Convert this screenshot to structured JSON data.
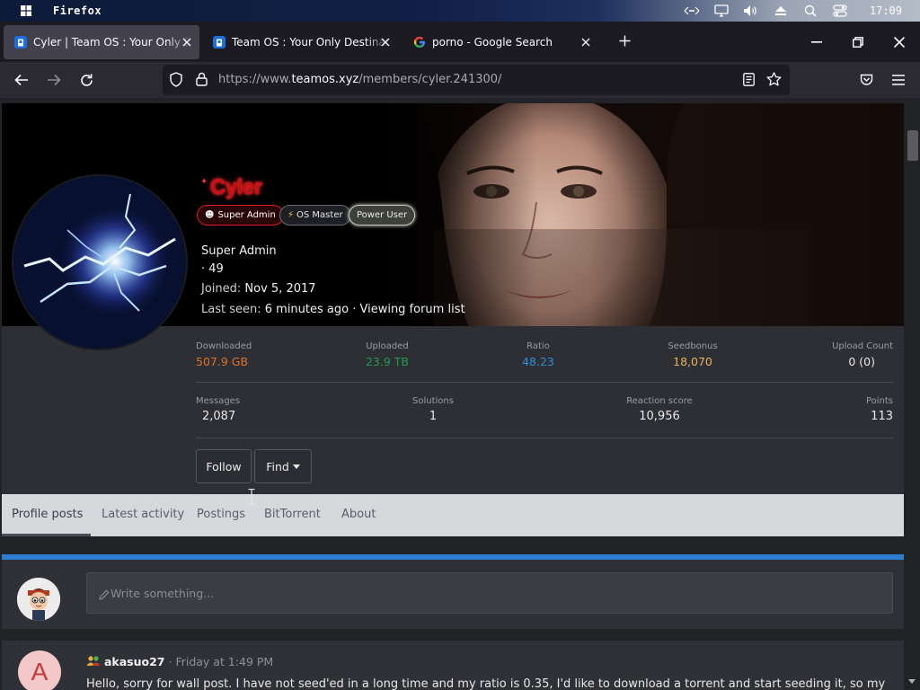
{
  "os": {
    "app_name": "Firefox",
    "clock": "17:09"
  },
  "browser": {
    "tabs": [
      {
        "title": "Cyler | Team OS : Your Only Destination",
        "active": true
      },
      {
        "title": "Team OS : Your Only Destination",
        "active": false
      },
      {
        "title": "porno - Google Search",
        "active": false
      }
    ],
    "url_prefix": "https://www.",
    "url_domain": "teamos.xyz",
    "url_path": "/members/cyler.241300/"
  },
  "profile": {
    "username": "Cyler",
    "badges": {
      "super_admin": "Super Admin",
      "os_master": "OS Master",
      "power_user": "Power User"
    },
    "title": "Super Admin",
    "rank": "· 49",
    "joined_label": "Joined:",
    "joined_value": "Nov 5, 2017",
    "last_seen_label": "Last seen:",
    "last_seen_value": "6 minutes ago · Viewing forum list",
    "stats_top": {
      "downloaded": {
        "label": "Downloaded",
        "value": "507.9 GB"
      },
      "uploaded": {
        "label": "Uploaded",
        "value": "23.9 TB"
      },
      "ratio": {
        "label": "Ratio",
        "value": "48.23"
      },
      "seedbonus": {
        "label": "Seedbonus",
        "value": "18,070"
      },
      "upload_count": {
        "label": "Upload Count",
        "value": "0 (0)"
      }
    },
    "stats_bottom": {
      "messages": {
        "label": "Messages",
        "value": "2,087"
      },
      "solutions": {
        "label": "Solutions",
        "value": "1"
      },
      "reaction": {
        "label": "Reaction score",
        "value": "10,956"
      },
      "points": {
        "label": "Points",
        "value": "113"
      }
    },
    "follow_label": "Follow",
    "find_label": "Find"
  },
  "profile_tabs": [
    "Profile posts",
    "Latest activity",
    "Postings",
    "BitTorrent",
    "About"
  ],
  "composer": {
    "placeholder": "Write something..."
  },
  "wall_post": {
    "avatar_letter": "A",
    "user": "akasuo27",
    "time": "· Friday at 1:49 PM",
    "text": "Hello, sorry for wall post. I have not seed'ed in a long time and my ratio is 0.35, I'd like to download a torrent and start seeding it, so my"
  },
  "colors": {
    "downloaded": "#e0702a",
    "uploaded": "#1f9a52",
    "ratio": "#2e8ed8",
    "seedbonus": "#e8b45a",
    "accent_bar": "#2f7fd1",
    "username": "#c90f0f"
  }
}
